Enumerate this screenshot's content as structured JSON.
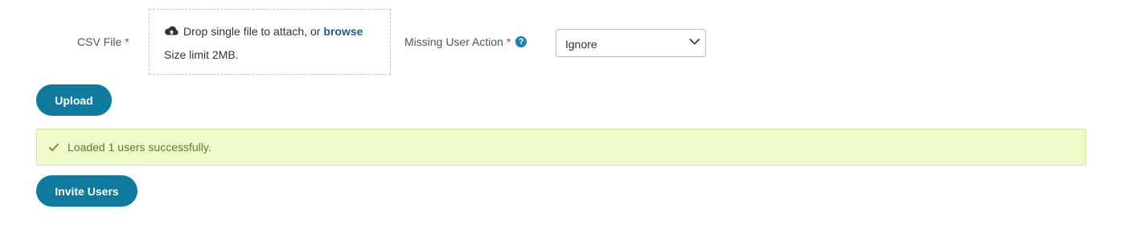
{
  "csv_file": {
    "label": "CSV File",
    "required_mark": "*",
    "dropzone": {
      "icon": "cloud-upload-icon",
      "prompt": "Drop single file to attach, or",
      "browse_link": "browse",
      "size_limit": "Size limit 2MB."
    }
  },
  "missing_user_action": {
    "label": "Missing User Action",
    "required_mark": "*",
    "help_icon": "question-circle-icon",
    "selected": "Ignore"
  },
  "upload_button": "Upload",
  "alert": {
    "icon": "check-icon",
    "message": "Loaded 1 users successfully."
  },
  "invite_button": "Invite Users",
  "colors": {
    "primary_button": "#0f7a9e",
    "link": "#1d5c86",
    "required": "#c0392b",
    "success_bg": "#eefcc9",
    "success_text": "#5c7a2c"
  }
}
